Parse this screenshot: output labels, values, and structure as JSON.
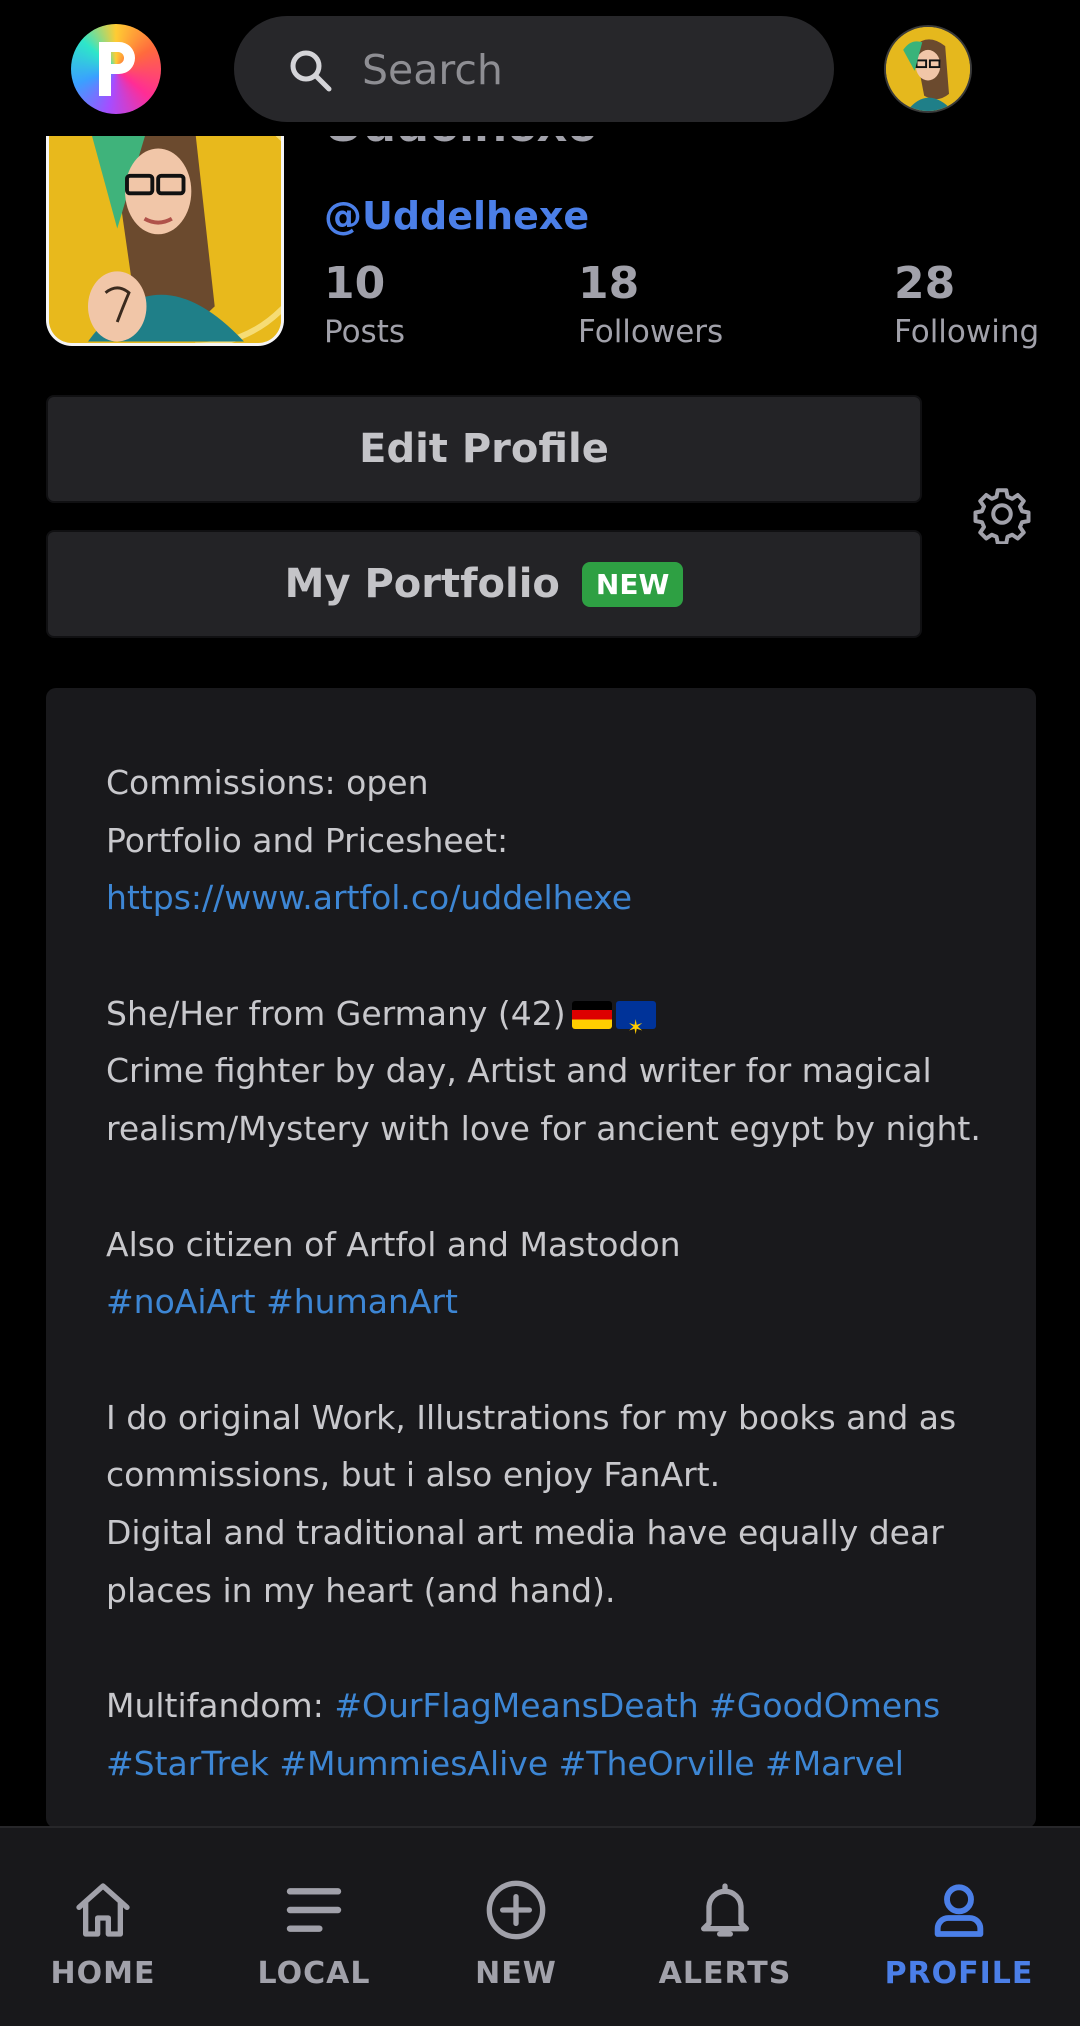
{
  "search": {
    "placeholder": "Search"
  },
  "profile": {
    "display_name": "Uddelhexe",
    "handle": "@Uddelhexe",
    "stats": [
      {
        "value": "10",
        "label": "Posts"
      },
      {
        "value": "18",
        "label": "Followers"
      },
      {
        "value": "28",
        "label": "Following"
      }
    ]
  },
  "buttons": {
    "edit_profile": "Edit Profile",
    "portfolio": "My Portfolio",
    "portfolio_badge": "NEW"
  },
  "bio": {
    "commissions": "Commissions: open",
    "portfolio_label": "Portfolio and Pricesheet:",
    "portfolio_link": "https://www.artfol.co/uddelhexe",
    "about": "She/Her from Germany (42)",
    "flags": [
      "flag-germany-icon",
      "flag-eu-icon"
    ],
    "line_crime": "Crime fighter by day, Artist and writer for magical",
    "line_realism": "realism/Mystery with love for ancient egypt by night.",
    "citizen": "Also citizen of Artfol and Mastodon",
    "tags1": [
      "#noAiArt",
      "#humanArt"
    ],
    "work1": "I do original Work, Illustrations for my books and as",
    "work2": "commissions, but i also enjoy FanArt.",
    "work3": "Digital and traditional art media have equally dear",
    "work4": "places in my heart (and hand).",
    "fandom_label": "Multifandom:",
    "fandom_tags_line1": [
      "#OurFlagMeansDeath",
      "#GoodOmens"
    ],
    "fandom_tags_line2": [
      "#StarTrek",
      "#MummiesAlive",
      "#TheOrville",
      "#Marvel"
    ]
  },
  "nav": [
    {
      "label": "HOME",
      "icon": "home-icon"
    },
    {
      "label": "LOCAL",
      "icon": "list-icon"
    },
    {
      "label": "NEW",
      "icon": "plus-circle-icon"
    },
    {
      "label": "ALERTS",
      "icon": "bell-icon"
    },
    {
      "label": "PROFILE",
      "icon": "user-icon"
    }
  ],
  "colors": {
    "accent": "#4b7fe8",
    "link": "#3d86d4",
    "badge": "#2ea043",
    "background": "#000000",
    "card": "#19191c"
  }
}
